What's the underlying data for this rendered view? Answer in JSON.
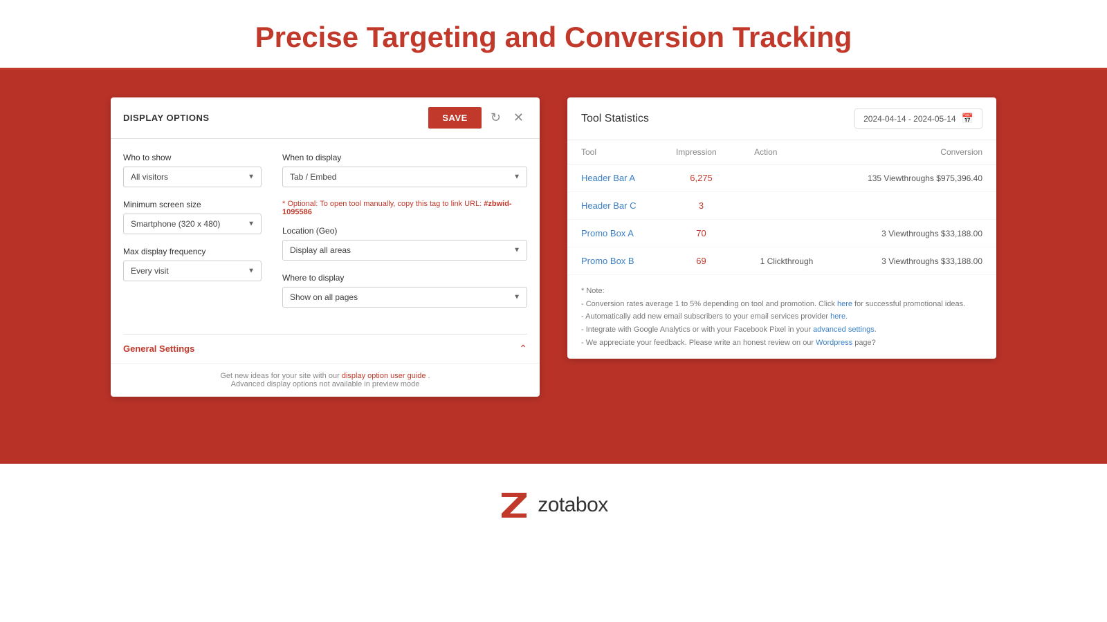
{
  "header": {
    "title": "Precise Targeting and Conversion Tracking"
  },
  "display_options": {
    "card_title": "DISPLAY OPTIONS",
    "save_label": "SAVE",
    "who_to_show": {
      "label": "Who to show",
      "options": [
        "All visitors"
      ],
      "selected": "All visitors"
    },
    "min_screen_size": {
      "label": "Minimum screen size",
      "options": [
        "Smartphone (320 x 480)"
      ],
      "selected": "Smartphone (320 x 480)"
    },
    "max_display_frequency": {
      "label": "Max display frequency",
      "options": [
        "Every visit"
      ],
      "selected": "Every visit"
    },
    "when_to_display": {
      "label": "When to display",
      "options": [
        "Tab / Embed"
      ],
      "selected": "Tab / Embed"
    },
    "optional_note": "* Optional: To open tool manually, copy this tag to link URL:",
    "tag_value": "#zbwid-1095586",
    "location_geo": {
      "label": "Location (Geo)",
      "options": [
        "Display all areas"
      ],
      "selected": "Display all areas"
    },
    "where_to_display": {
      "label": "Where to display",
      "options": [
        "Show on all pages"
      ],
      "selected": "Show on all pages"
    },
    "general_settings_label": "General Settings",
    "footer_text1": "Get new ideas for your site with our",
    "footer_link": "display option user guide",
    "footer_text2": ".",
    "footer_note": "Advanced display options not available in preview mode"
  },
  "tool_statistics": {
    "title": "Tool Statistics",
    "date_range": "2024-04-14 - 2024-05-14",
    "columns": [
      "Tool",
      "Impression",
      "Action",
      "Conversion"
    ],
    "rows": [
      {
        "tool": "Header Bar A",
        "impression": "6,275",
        "action": "",
        "conversion": "135 Viewthroughs $975,396.40"
      },
      {
        "tool": "Header Bar C",
        "impression": "3",
        "action": "",
        "conversion": ""
      },
      {
        "tool": "Promo Box A",
        "impression": "70",
        "action": "",
        "conversion": "3 Viewthroughs $33,188.00"
      },
      {
        "tool": "Promo Box B",
        "impression": "69",
        "action": "1 Clickthrough",
        "conversion": "3 Viewthroughs $33,188.00"
      }
    ],
    "notes": [
      "* Note:",
      "- Conversion rates average 1 to 5% depending on tool and promotion. Click here for successful promotional ideas.",
      "- Automatically add new email subscribers to your email services provider here.",
      "- Integrate with Google Analytics or with your Facebook Pixel in your advanced settings.",
      "- We appreciate your feedback. Please write an honest review on our Wordpress page?"
    ]
  },
  "footer": {
    "brand_name": "zotabox"
  }
}
